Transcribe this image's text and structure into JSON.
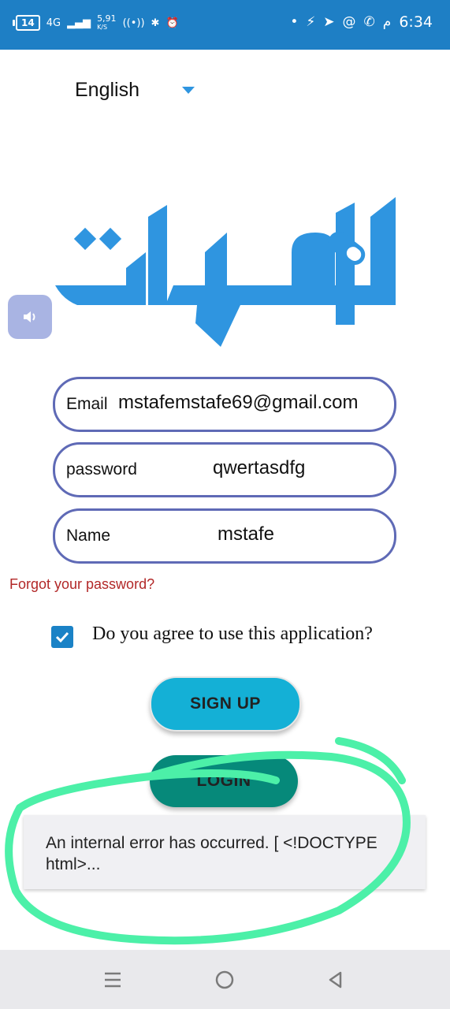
{
  "status_bar": {
    "battery": "14",
    "network": "4G",
    "speed_value": "5,91",
    "speed_unit": "K/S",
    "time": "6:34",
    "ampm": "م"
  },
  "language": {
    "selected": "English"
  },
  "logo": {
    "text": "الفرات"
  },
  "form": {
    "email": {
      "label": "Email",
      "value": "mstafemstafe69@gmail.com"
    },
    "password": {
      "label": "password",
      "value": "qwertasdfg"
    },
    "name": {
      "label": "Name",
      "value": "mstafe"
    }
  },
  "forgot_password": "Forgot your password?",
  "agreement": {
    "text": "Do you agree to use this application?",
    "checked": true
  },
  "buttons": {
    "signup": "SIGN UP",
    "login": "LOGIN"
  },
  "toast": {
    "message": "An internal error has occurred. [ <!DOCTYPE html>..."
  },
  "colors": {
    "status_bar": "#1e7fc5",
    "field_border": "#5f6ab6",
    "signup": "#14b0d6",
    "login": "#06897a",
    "annotation": "#4cf0a8",
    "logo": "#2f95e0"
  }
}
